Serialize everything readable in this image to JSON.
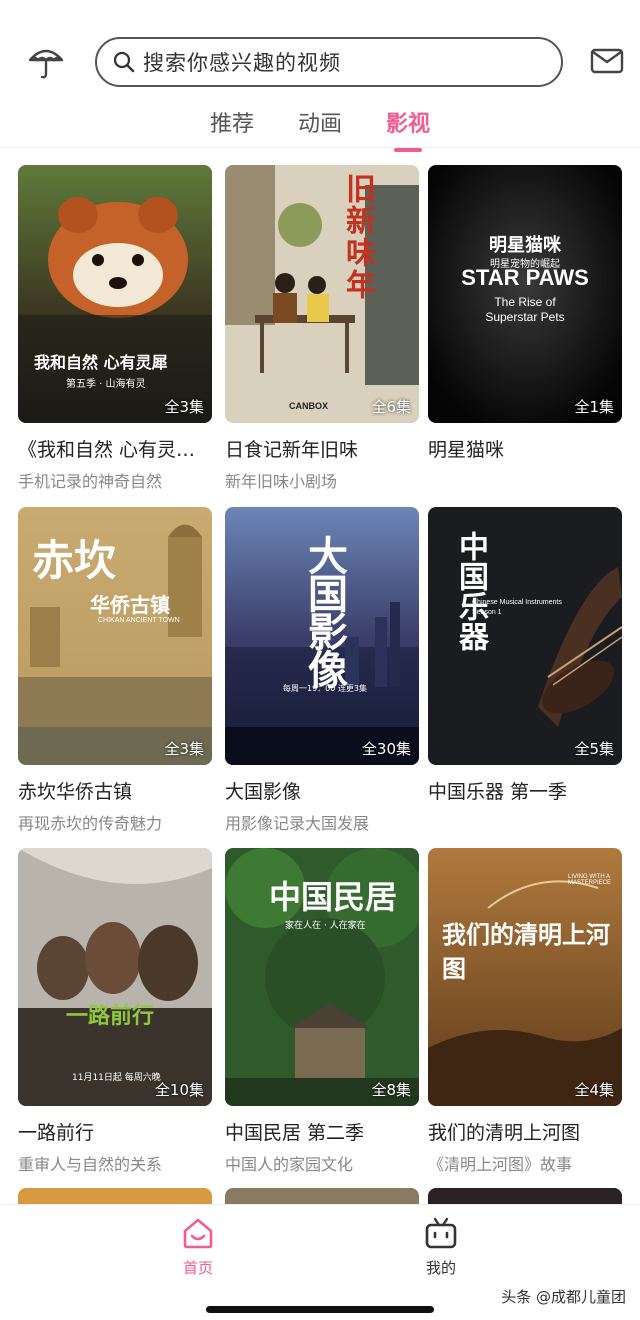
{
  "search": {
    "placeholder": "搜索你感兴趣的视频"
  },
  "tabs": [
    {
      "label": "推荐",
      "active": false
    },
    {
      "label": "动画",
      "active": false
    },
    {
      "label": "影视",
      "active": true
    }
  ],
  "colors": {
    "accent": "#f25c93"
  },
  "items": [
    {
      "title": "《我和自然 心有灵犀》",
      "subtitle": "手机记录的神奇自然",
      "episodes": "全3集",
      "poster_text": "我和自然 心有灵犀",
      "poster_sub": "第五季 · 山海有灵"
    },
    {
      "title": "日食记新年旧味",
      "subtitle": "新年旧味小剧场",
      "episodes": "全6集",
      "poster_text": "旧新味年",
      "poster_sub": "CANBOX"
    },
    {
      "title": "明星猫咪",
      "subtitle": "",
      "episodes": "全1集",
      "poster_text": "明星猫咪",
      "poster_sub": "明星宠物的崛起",
      "poster_en": "STAR PAWS",
      "poster_en2": "The Rise of",
      "poster_en3": "Superstar Pets"
    },
    {
      "title": "赤坎华侨古镇",
      "subtitle": "再现赤坎的传奇魅力",
      "episodes": "全3集",
      "poster_text": "赤坎",
      "poster_sub": "华侨古镇",
      "poster_en": "CHIKAN ANCIENT TOWN"
    },
    {
      "title": "大国影像",
      "subtitle": "用影像记录大国发展",
      "episodes": "全30集",
      "poster_text": "大国影像",
      "poster_sub": "每周一19：00 连更3集"
    },
    {
      "title": "中国乐器 第一季",
      "subtitle": "",
      "episodes": "全5集",
      "poster_text": "中国乐器",
      "poster_en": "Chinese Musical Instruments",
      "poster_en2": "Season 1"
    },
    {
      "title": "一路前行",
      "subtitle": "重审人与自然的关系",
      "episodes": "全10集",
      "poster_text": "一路前行",
      "poster_sub": "11月11日起 每周六晚"
    },
    {
      "title": "中国民居 第二季",
      "subtitle": "中国人的家园文化",
      "episodes": "全8集",
      "poster_text": "中国民居",
      "poster_sub": "家在人在 · 人在家在"
    },
    {
      "title": "我们的清明上河图",
      "subtitle": "《清明上河图》故事",
      "episodes": "全4集",
      "poster_text": "我们的清明上河图",
      "poster_en": "LIVING WITH A MASTERPIECE"
    }
  ],
  "bottom_nav": [
    {
      "label": "首页",
      "icon": "home-icon",
      "active": true
    },
    {
      "label": "我的",
      "icon": "tv-icon",
      "active": false
    }
  ],
  "watermark": "头条 @成都儿童团"
}
